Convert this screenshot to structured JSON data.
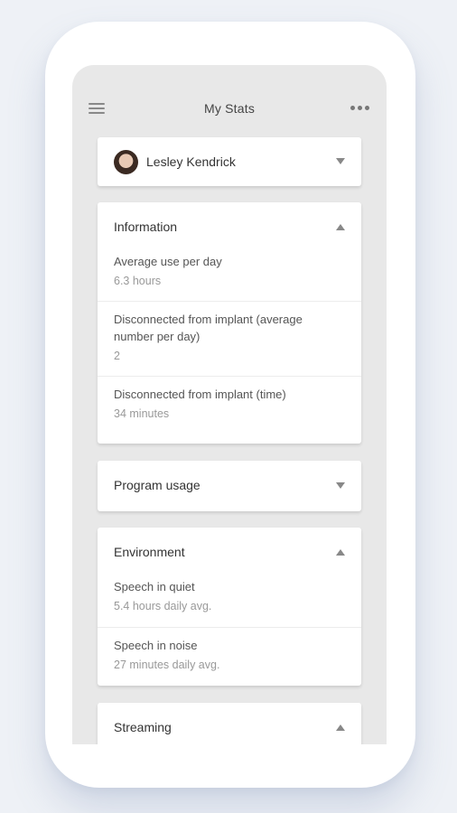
{
  "header": {
    "title": "My Stats",
    "menu_icon": "hamburger-menu-icon",
    "more_icon": "more-options-icon"
  },
  "profile": {
    "name": "Lesley Kendrick",
    "avatar": "user-avatar"
  },
  "information": {
    "title": "Information",
    "items": [
      {
        "label": "Average use per day",
        "value": "6.3 hours"
      },
      {
        "label": "Disconnected from implant (average number per day)",
        "value": "2"
      },
      {
        "label": "Disconnected from implant (time)",
        "value": "34 minutes"
      }
    ]
  },
  "program_usage": {
    "title": "Program usage"
  },
  "environment": {
    "title": "Environment",
    "items": [
      {
        "label": "Speech in quiet",
        "value": "5.4 hours daily avg."
      },
      {
        "label": "Speech in noise",
        "value": "27 minutes daily avg."
      }
    ]
  },
  "streaming": {
    "title": "Streaming"
  },
  "colors": {
    "page_background": "#eef1f6",
    "screen_background": "#e8e8e8",
    "card_background": "#ffffff"
  }
}
